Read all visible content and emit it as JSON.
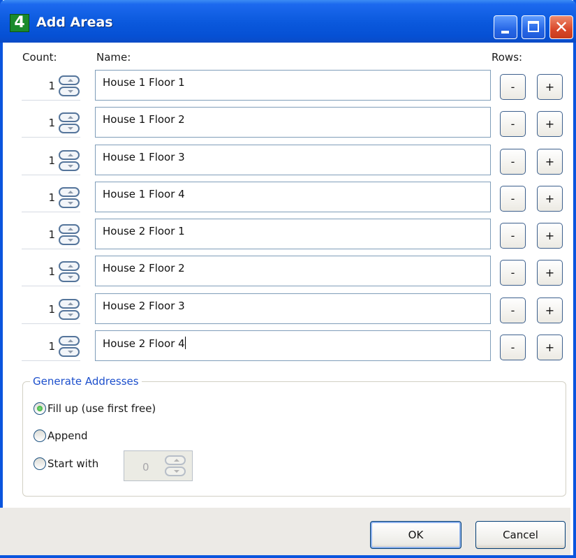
{
  "window": {
    "title": "Add Areas",
    "icon_label": "4",
    "controls": [
      "minimize",
      "maximize",
      "close"
    ],
    "close_glyph": "✕"
  },
  "headers": {
    "count": "Count:",
    "name": "Name:",
    "rows": "Rows:"
  },
  "rows": [
    {
      "count": "1",
      "name": "House 1 Floor 1"
    },
    {
      "count": "1",
      "name": "House 1 Floor 2"
    },
    {
      "count": "1",
      "name": "House 1 Floor 3"
    },
    {
      "count": "1",
      "name": "House 1 Floor 4"
    },
    {
      "count": "1",
      "name": "House 2 Floor 1"
    },
    {
      "count": "1",
      "name": "House 2 Floor 2"
    },
    {
      "count": "1",
      "name": "House 2 Floor 3"
    },
    {
      "count": "1",
      "name": "House 2 Floor 4",
      "focused": true
    }
  ],
  "row_buttons": {
    "minus": "-",
    "plus": "+"
  },
  "generate": {
    "legend": "Generate Addresses",
    "options": [
      {
        "label": "Fill up (use first free)",
        "checked": true
      },
      {
        "label": "Append",
        "checked": false
      },
      {
        "label": "Start with",
        "checked": false
      }
    ],
    "start_with_value": "0"
  },
  "buttons": {
    "ok": "OK",
    "cancel": "Cancel"
  },
  "colors": {
    "titlebar": "#0a58dc",
    "legend_text": "#1c4fcc",
    "footer": "#eceae6"
  }
}
